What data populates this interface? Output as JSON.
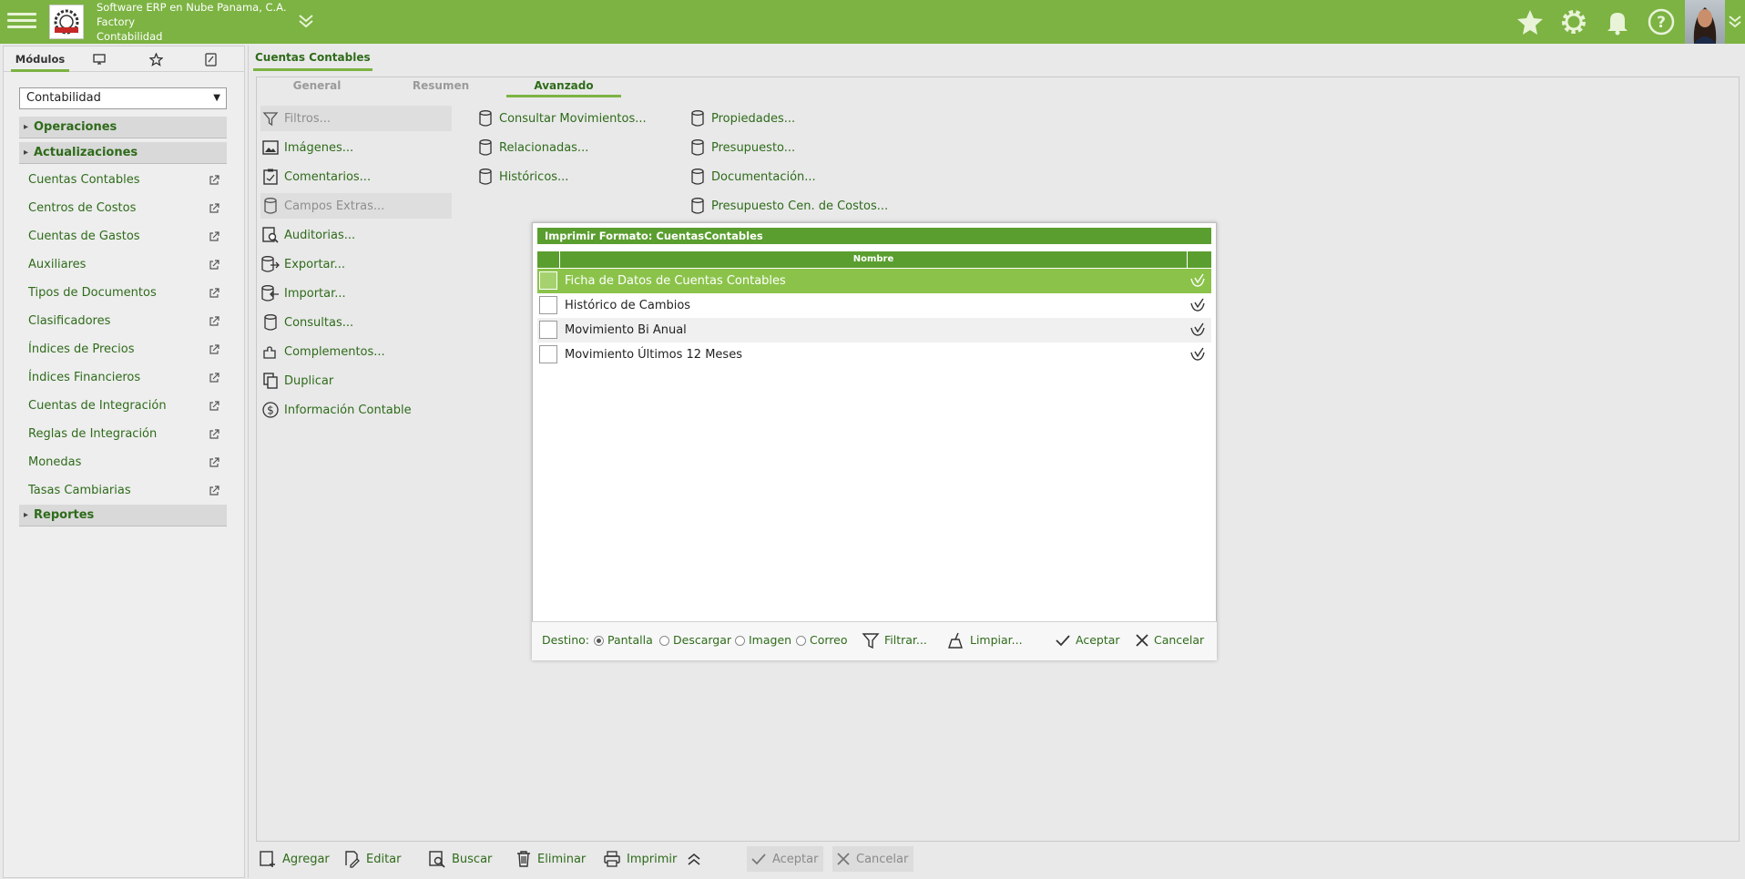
{
  "header": {
    "company_line1": "Software ERP en Nube Panama, C.A.",
    "company_line2": "Factory",
    "company_line3": "Contabilidad",
    "color": "#7cb342"
  },
  "left_tabs": [
    "Módulos",
    "monitor-icon",
    "star-icon",
    "notes-icon"
  ],
  "left": {
    "module_selected": "Contabilidad",
    "sections": {
      "operaciones": "Operaciones",
      "actualizaciones": "Actualizaciones",
      "reportes": "Reportes"
    },
    "items": [
      "Cuentas Contables",
      "Centros de Costos",
      "Cuentas de Gastos",
      "Auxiliares",
      "Tipos de Documentos",
      "Clasificadores",
      "Índices de Precios",
      "Índices Financieros",
      "Cuentas de Integración",
      "Reglas de Integración",
      "Monedas",
      "Tasas Cambiarias"
    ]
  },
  "main": {
    "tab": "Cuentas Contables",
    "subtabs": [
      "General",
      "Resumen",
      "Avanzado"
    ],
    "actions_col1": [
      "Filtros...",
      "Imágenes...",
      "Comentarios...",
      "Campos Extras...",
      "Auditorias...",
      "Exportar...",
      "Importar...",
      "Consultas...",
      "Complementos...",
      "Duplicar",
      "Información Contable"
    ],
    "actions_col2": [
      "Consultar Movimientos...",
      "Relacionadas...",
      "Históricos..."
    ],
    "actions_col3": [
      "Propiedades...",
      "Presupuesto...",
      "Documentación...",
      "Presupuesto Cen. de Costos..."
    ]
  },
  "dialog": {
    "title": "Imprimir Formato: CuentasContables",
    "column_header": "Nombre",
    "rows": [
      "Ficha de Datos de Cuentas Contables",
      "Histórico de Cambios",
      "Movimiento Bi Anual",
      "Movimiento Últimos 12 Meses"
    ],
    "destino_label": "Destino:",
    "destinations": [
      "Pantalla",
      "Descargar",
      "Imagen",
      "Correo"
    ],
    "selected_destination": "Pantalla",
    "filtrar": "Filtrar...",
    "limpiar": "Limpiar...",
    "aceptar": "Aceptar",
    "cancelar": "Cancelar"
  },
  "toolbar": {
    "agregar": "Agregar",
    "editar": "Editar",
    "buscar": "Buscar",
    "eliminar": "Eliminar",
    "imprimir": "Imprimir",
    "aceptar": "Aceptar",
    "cancelar": "Cancelar"
  }
}
